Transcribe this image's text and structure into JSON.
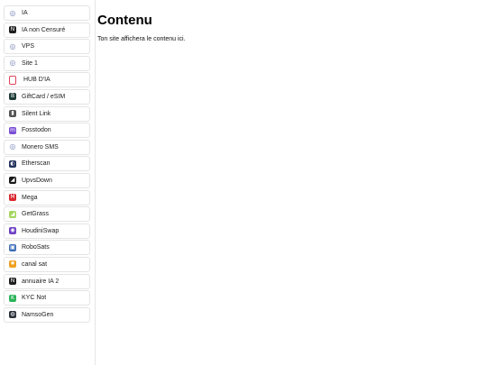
{
  "sidebar": {
    "items": [
      {
        "label": "IA",
        "icon": "globe-icon",
        "color": "#7a86b8",
        "glyph": "◎"
      },
      {
        "label": "IA non Censuré",
        "icon": "letter-n-icon",
        "color": "#1f1f1f",
        "glyph": "N"
      },
      {
        "label": "VPS",
        "icon": "globe-icon",
        "color": "#7a86b8",
        "glyph": "◎"
      },
      {
        "label": "Site 1",
        "icon": "globe-icon",
        "color": "#7a86b8",
        "glyph": "◎"
      },
      {
        "label": "HUB D'IA",
        "icon": "bookmark-icon",
        "color": "#e0445a",
        "glyph": "⌑"
      },
      {
        "label": "GiftCard / eSIM",
        "icon": "letter-b-icon",
        "color": "#1c3a35",
        "glyph": "B"
      },
      {
        "label": "Silent Link",
        "icon": "phone-icon",
        "color": "#555555",
        "glyph": "▮"
      },
      {
        "label": "Fosstodon",
        "icon": "mastodon-icon",
        "color": "#7a4fd6",
        "glyph": "m"
      },
      {
        "label": "Monero SMS",
        "icon": "globe-icon",
        "color": "#7a86b8",
        "glyph": "◎"
      },
      {
        "label": "Etherscan",
        "icon": "etherscan-icon",
        "color": "#21325b",
        "glyph": "◐"
      },
      {
        "label": "UpvsDown",
        "icon": "updown-icon",
        "color": "#1a1a1a",
        "glyph": "◢"
      },
      {
        "label": "Mega",
        "icon": "mega-icon",
        "color": "#d9272e",
        "glyph": "M"
      },
      {
        "label": "GetGrass",
        "icon": "grass-icon",
        "color": "#a4d65e",
        "glyph": "◢"
      },
      {
        "label": "HoudiniSwap",
        "icon": "houdini-icon",
        "color": "#6d3fc4",
        "glyph": "◉"
      },
      {
        "label": "RoboSats",
        "icon": "robot-icon",
        "color": "#3d6fb5",
        "glyph": "▣"
      },
      {
        "label": "canal sat",
        "icon": "star-icon",
        "color": "#f0a020",
        "glyph": "✸"
      },
      {
        "label": "annuaire IA 2",
        "icon": "letter-n-icon",
        "color": "#1f1f1f",
        "glyph": "N"
      },
      {
        "label": "KYC Not",
        "icon": "letter-k-icon",
        "color": "#2bb35a",
        "glyph": "K"
      },
      {
        "label": "NamsoGen",
        "icon": "namsogen-icon",
        "color": "#2a2f3a",
        "glyph": "◍"
      }
    ]
  },
  "main": {
    "title": "Contenu",
    "body": "Ton site affichera le contenu ici."
  }
}
